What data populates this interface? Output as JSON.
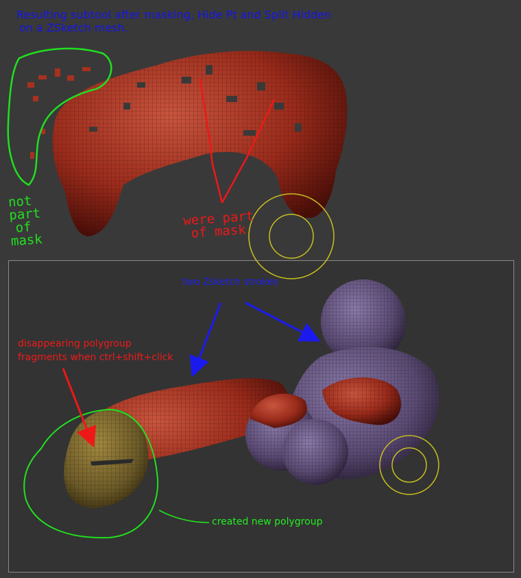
{
  "top_section": {
    "title_line1": "Resulting subtool after masking, Hide Pt and Split Hidden",
    "title_line2": "on a ZSketch mesh.",
    "note_green": [
      "not",
      "part",
      "of",
      "mask"
    ],
    "note_red": [
      "were part",
      "of mask"
    ]
  },
  "bottom_section": {
    "label_strokes": "two Zsketch strokes",
    "label_disappearing": [
      "disappearing polygroup",
      "fragments when ctrl+shift+click"
    ],
    "label_new_polygroup": "created new polygroup"
  },
  "colors": {
    "title_blue": "#1616e6",
    "annotation_green": "#20e020",
    "annotation_red": "#ee1818",
    "mesh_red": "#a8301f",
    "mesh_purple": "#6a5a86",
    "mesh_olive": "#7a6a30",
    "cursor_yellow": "#c8c020"
  }
}
